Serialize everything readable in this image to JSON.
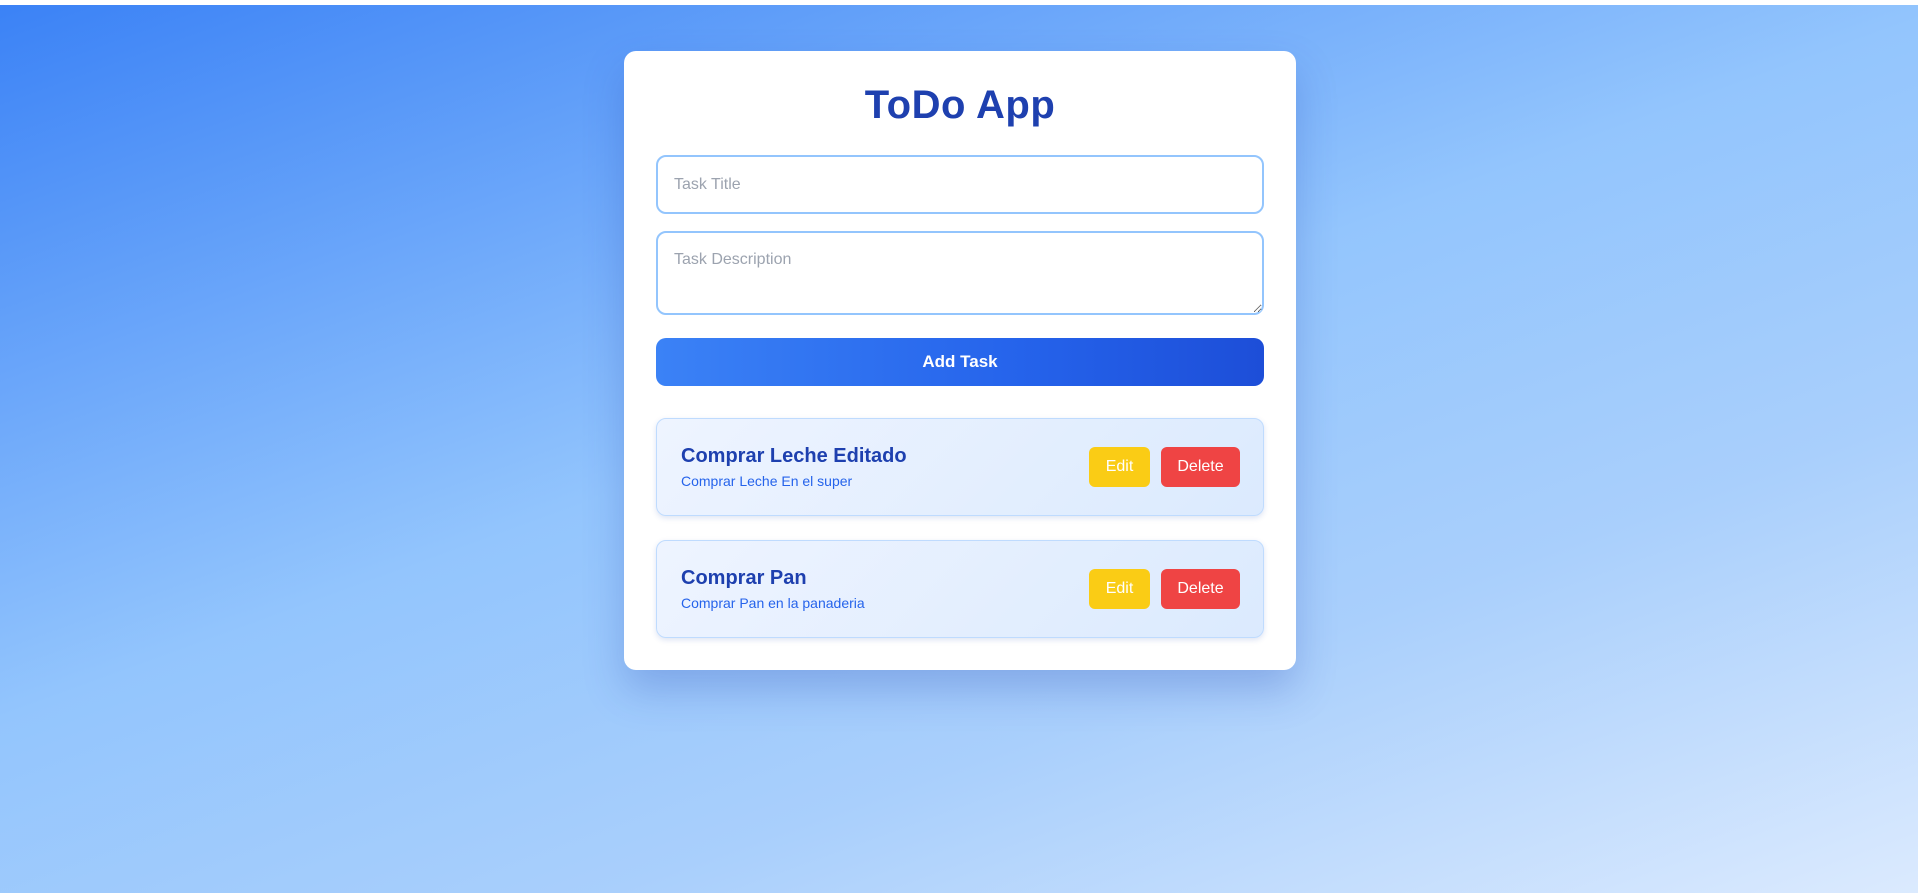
{
  "app": {
    "title": "ToDo App"
  },
  "form": {
    "title_placeholder": "Task Title",
    "title_value": "",
    "description_placeholder": "Task Description",
    "description_value": "",
    "add_button_label": "Add Task"
  },
  "tasks": [
    {
      "title": "Comprar Leche Editado",
      "description": "Comprar Leche En el super",
      "edit_label": "Edit",
      "delete_label": "Delete"
    },
    {
      "title": "Comprar Pan",
      "description": "Comprar Pan en la panaderia",
      "edit_label": "Edit",
      "delete_label": "Delete"
    }
  ],
  "colors": {
    "accent": "#1e40af",
    "primary_button": "#2563eb",
    "edit_button": "#facc15",
    "delete_button": "#ef4444",
    "input_border": "#93c5fd"
  }
}
